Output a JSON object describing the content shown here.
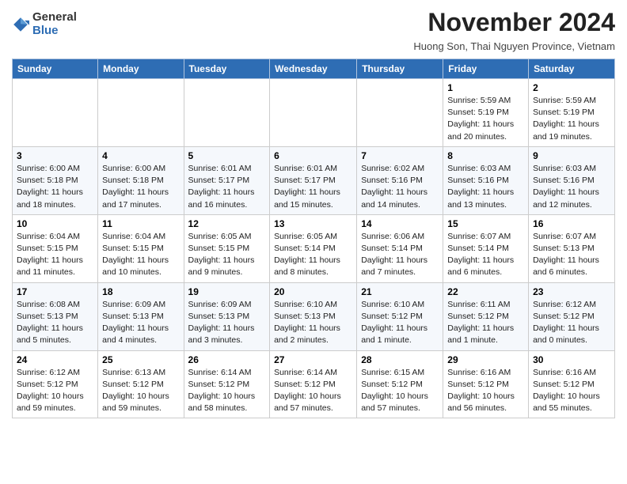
{
  "logo": {
    "general": "General",
    "blue": "Blue"
  },
  "title": "November 2024",
  "subtitle": "Huong Son, Thai Nguyen Province, Vietnam",
  "header": {
    "days": [
      "Sunday",
      "Monday",
      "Tuesday",
      "Wednesday",
      "Thursday",
      "Friday",
      "Saturday"
    ]
  },
  "weeks": [
    [
      {
        "day": "",
        "info": ""
      },
      {
        "day": "",
        "info": ""
      },
      {
        "day": "",
        "info": ""
      },
      {
        "day": "",
        "info": ""
      },
      {
        "day": "",
        "info": ""
      },
      {
        "day": "1",
        "info": "Sunrise: 5:59 AM\nSunset: 5:19 PM\nDaylight: 11 hours\nand 20 minutes."
      },
      {
        "day": "2",
        "info": "Sunrise: 5:59 AM\nSunset: 5:19 PM\nDaylight: 11 hours\nand 19 minutes."
      }
    ],
    [
      {
        "day": "3",
        "info": "Sunrise: 6:00 AM\nSunset: 5:18 PM\nDaylight: 11 hours\nand 18 minutes."
      },
      {
        "day": "4",
        "info": "Sunrise: 6:00 AM\nSunset: 5:18 PM\nDaylight: 11 hours\nand 17 minutes."
      },
      {
        "day": "5",
        "info": "Sunrise: 6:01 AM\nSunset: 5:17 PM\nDaylight: 11 hours\nand 16 minutes."
      },
      {
        "day": "6",
        "info": "Sunrise: 6:01 AM\nSunset: 5:17 PM\nDaylight: 11 hours\nand 15 minutes."
      },
      {
        "day": "7",
        "info": "Sunrise: 6:02 AM\nSunset: 5:16 PM\nDaylight: 11 hours\nand 14 minutes."
      },
      {
        "day": "8",
        "info": "Sunrise: 6:03 AM\nSunset: 5:16 PM\nDaylight: 11 hours\nand 13 minutes."
      },
      {
        "day": "9",
        "info": "Sunrise: 6:03 AM\nSunset: 5:16 PM\nDaylight: 11 hours\nand 12 minutes."
      }
    ],
    [
      {
        "day": "10",
        "info": "Sunrise: 6:04 AM\nSunset: 5:15 PM\nDaylight: 11 hours\nand 11 minutes."
      },
      {
        "day": "11",
        "info": "Sunrise: 6:04 AM\nSunset: 5:15 PM\nDaylight: 11 hours\nand 10 minutes."
      },
      {
        "day": "12",
        "info": "Sunrise: 6:05 AM\nSunset: 5:15 PM\nDaylight: 11 hours\nand 9 minutes."
      },
      {
        "day": "13",
        "info": "Sunrise: 6:05 AM\nSunset: 5:14 PM\nDaylight: 11 hours\nand 8 minutes."
      },
      {
        "day": "14",
        "info": "Sunrise: 6:06 AM\nSunset: 5:14 PM\nDaylight: 11 hours\nand 7 minutes."
      },
      {
        "day": "15",
        "info": "Sunrise: 6:07 AM\nSunset: 5:14 PM\nDaylight: 11 hours\nand 6 minutes."
      },
      {
        "day": "16",
        "info": "Sunrise: 6:07 AM\nSunset: 5:13 PM\nDaylight: 11 hours\nand 6 minutes."
      }
    ],
    [
      {
        "day": "17",
        "info": "Sunrise: 6:08 AM\nSunset: 5:13 PM\nDaylight: 11 hours\nand 5 minutes."
      },
      {
        "day": "18",
        "info": "Sunrise: 6:09 AM\nSunset: 5:13 PM\nDaylight: 11 hours\nand 4 minutes."
      },
      {
        "day": "19",
        "info": "Sunrise: 6:09 AM\nSunset: 5:13 PM\nDaylight: 11 hours\nand 3 minutes."
      },
      {
        "day": "20",
        "info": "Sunrise: 6:10 AM\nSunset: 5:13 PM\nDaylight: 11 hours\nand 2 minutes."
      },
      {
        "day": "21",
        "info": "Sunrise: 6:10 AM\nSunset: 5:12 PM\nDaylight: 11 hours\nand 1 minute."
      },
      {
        "day": "22",
        "info": "Sunrise: 6:11 AM\nSunset: 5:12 PM\nDaylight: 11 hours\nand 1 minute."
      },
      {
        "day": "23",
        "info": "Sunrise: 6:12 AM\nSunset: 5:12 PM\nDaylight: 11 hours\nand 0 minutes."
      }
    ],
    [
      {
        "day": "24",
        "info": "Sunrise: 6:12 AM\nSunset: 5:12 PM\nDaylight: 10 hours\nand 59 minutes."
      },
      {
        "day": "25",
        "info": "Sunrise: 6:13 AM\nSunset: 5:12 PM\nDaylight: 10 hours\nand 59 minutes."
      },
      {
        "day": "26",
        "info": "Sunrise: 6:14 AM\nSunset: 5:12 PM\nDaylight: 10 hours\nand 58 minutes."
      },
      {
        "day": "27",
        "info": "Sunrise: 6:14 AM\nSunset: 5:12 PM\nDaylight: 10 hours\nand 57 minutes."
      },
      {
        "day": "28",
        "info": "Sunrise: 6:15 AM\nSunset: 5:12 PM\nDaylight: 10 hours\nand 57 minutes."
      },
      {
        "day": "29",
        "info": "Sunrise: 6:16 AM\nSunset: 5:12 PM\nDaylight: 10 hours\nand 56 minutes."
      },
      {
        "day": "30",
        "info": "Sunrise: 6:16 AM\nSunset: 5:12 PM\nDaylight: 10 hours\nand 55 minutes."
      }
    ]
  ]
}
